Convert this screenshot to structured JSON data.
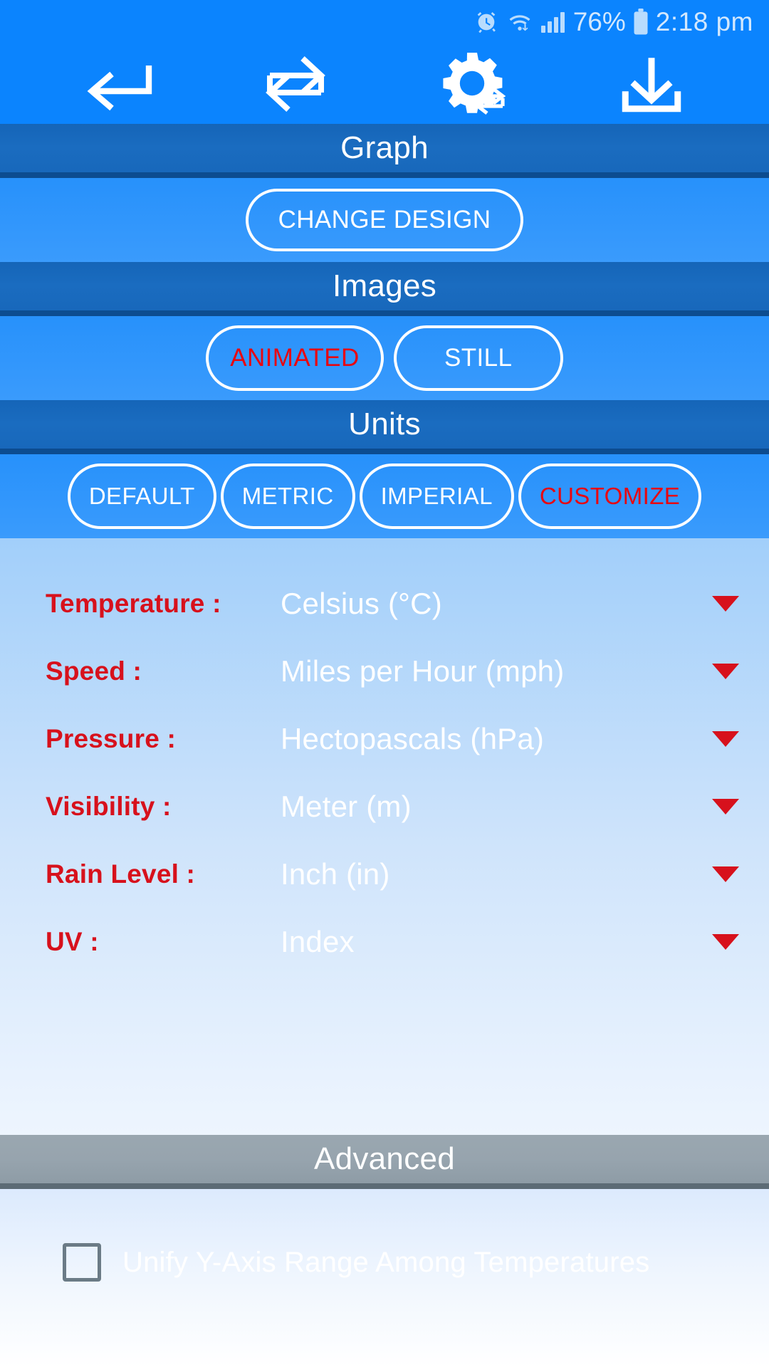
{
  "statusbar": {
    "alarm_icon": "alarm-clock-icon",
    "wifi_icon": "wifi-icon",
    "signal_icon": "signal-bars-icon",
    "battery_percent": "76%",
    "battery_icon": "battery-icon",
    "time": "2:18 pm"
  },
  "toolbar": {
    "back_icon": "back-arrow-icon",
    "swap_icon": "swap-arrows-icon",
    "settings_sync_icon": "gear-sync-icon",
    "download_icon": "download-icon"
  },
  "sections": {
    "graph": {
      "title": "Graph",
      "change_design_label": "CHANGE DESIGN"
    },
    "images": {
      "title": "Images",
      "options": [
        {
          "label": "ANIMATED",
          "selected": true
        },
        {
          "label": "STILL",
          "selected": false
        }
      ]
    },
    "units": {
      "title": "Units",
      "options": [
        {
          "label": "DEFAULT",
          "selected": false
        },
        {
          "label": "METRIC",
          "selected": false
        },
        {
          "label": "IMPERIAL",
          "selected": false
        },
        {
          "label": "CUSTOMIZE",
          "selected": true
        }
      ],
      "rows": [
        {
          "label": "Temperature :",
          "value": "Celsius (°C)"
        },
        {
          "label": "Speed :",
          "value": "Miles per Hour (mph)"
        },
        {
          "label": "Pressure :",
          "value": "Hectopascals (hPa)"
        },
        {
          "label": "Visibility :",
          "value": "Meter (m)"
        },
        {
          "label": "Rain Level :",
          "value": "Inch (in)"
        },
        {
          "label": "UV :",
          "value": "Index"
        }
      ]
    },
    "advanced": {
      "title": "Advanced",
      "checkbox_label": "Unify Y-Axis Range Among Temperatures",
      "checkbox_checked": false
    }
  },
  "colors": {
    "accent_blue": "#0b84fe",
    "header_blue": "#1a6cc0",
    "selected_red": "#e8070f",
    "label_red": "#d7111c",
    "header_gray": "#97a4ae"
  }
}
